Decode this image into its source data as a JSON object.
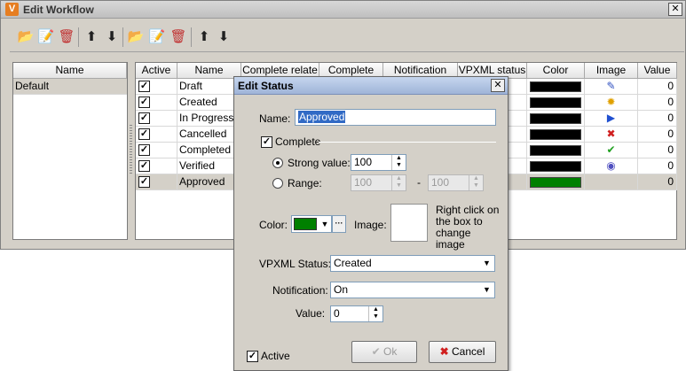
{
  "window": {
    "title": "Edit Workflow",
    "close_glyph": "✕",
    "logo_glyph": "V"
  },
  "toolbar": {
    "buttons": [
      {
        "name": "new-workflow-icon",
        "glyph": "📂"
      },
      {
        "name": "edit-workflow-icon",
        "glyph": "📝"
      },
      {
        "name": "delete-workflow-icon",
        "glyph": "🗑"
      },
      {
        "name": "move-workflow-up-icon",
        "glyph": "⬆"
      },
      {
        "name": "move-workflow-down-icon",
        "glyph": "⬇"
      },
      {
        "name": "new-status-icon",
        "glyph": "📂"
      },
      {
        "name": "edit-status-icon",
        "glyph": "📝"
      },
      {
        "name": "delete-status-icon",
        "glyph": "🗑"
      },
      {
        "name": "move-status-up-icon",
        "glyph": "⬆"
      },
      {
        "name": "move-status-down-icon",
        "glyph": "⬇"
      }
    ]
  },
  "workflows": {
    "header": "Name",
    "items": [
      "Default"
    ]
  },
  "statuses": {
    "columns": [
      "Active",
      "Name",
      "Complete relate",
      "Complete",
      "Notification",
      "VPXML status",
      "Color",
      "Image",
      "Value"
    ],
    "rows": [
      {
        "name": "Draft",
        "color": "#000000",
        "image": "draft-icon",
        "glyph": "✎",
        "glyph_color": "#3050c0",
        "value": "0"
      },
      {
        "name": "Created",
        "color": "#000000",
        "image": "created-icon",
        "glyph": "✹",
        "glyph_color": "#e0a000",
        "value": "0"
      },
      {
        "name": "In Progress",
        "color": "#000000",
        "image": "in-progress-icon",
        "glyph": "▶",
        "glyph_color": "#2050d0",
        "value": "0"
      },
      {
        "name": "Cancelled",
        "color": "#000000",
        "image": "cancelled-icon",
        "glyph": "✖",
        "glyph_color": "#d02020",
        "value": "0"
      },
      {
        "name": "Completed",
        "color": "#000000",
        "image": "completed-icon",
        "glyph": "✔",
        "glyph_color": "#20a020",
        "value": "0"
      },
      {
        "name": "Verified",
        "color": "#000000",
        "image": "verified-icon",
        "glyph": "◉",
        "glyph_color": "#5050c0",
        "value": "0"
      },
      {
        "name": "Approved",
        "color": "#008000",
        "image": "",
        "glyph": "",
        "glyph_color": "#000000",
        "value": "0"
      }
    ],
    "check_glyph": "✓"
  },
  "dialog": {
    "title": "Edit Status",
    "close_glyph": "✕",
    "name_label": "Name:",
    "name_value": "Approved",
    "complete_label": "Complete",
    "strong_label": "Strong value:",
    "strong_value": "100",
    "range_label": "Range:",
    "range_from": "100",
    "range_dash": "-",
    "range_to": "100",
    "color_label": "Color:",
    "color_value": "#008000",
    "more_glyph": "···",
    "image_label": "Image:",
    "image_hint": "Right click on the box to change image",
    "vpxml_label": "VPXML Status:",
    "vpxml_value": "Created",
    "notification_label": "Notification:",
    "notification_value": "On",
    "value_label": "Value:",
    "value_value": "0",
    "active_label": "Active",
    "ok_label": "Ok",
    "ok_glyph": "✔",
    "cancel_label": "Cancel",
    "cancel_glyph": "✖"
  },
  "glyphs": {
    "check": "✓",
    "dropdown": "▼",
    "spin_up": "▲",
    "spin_down": "▼"
  }
}
